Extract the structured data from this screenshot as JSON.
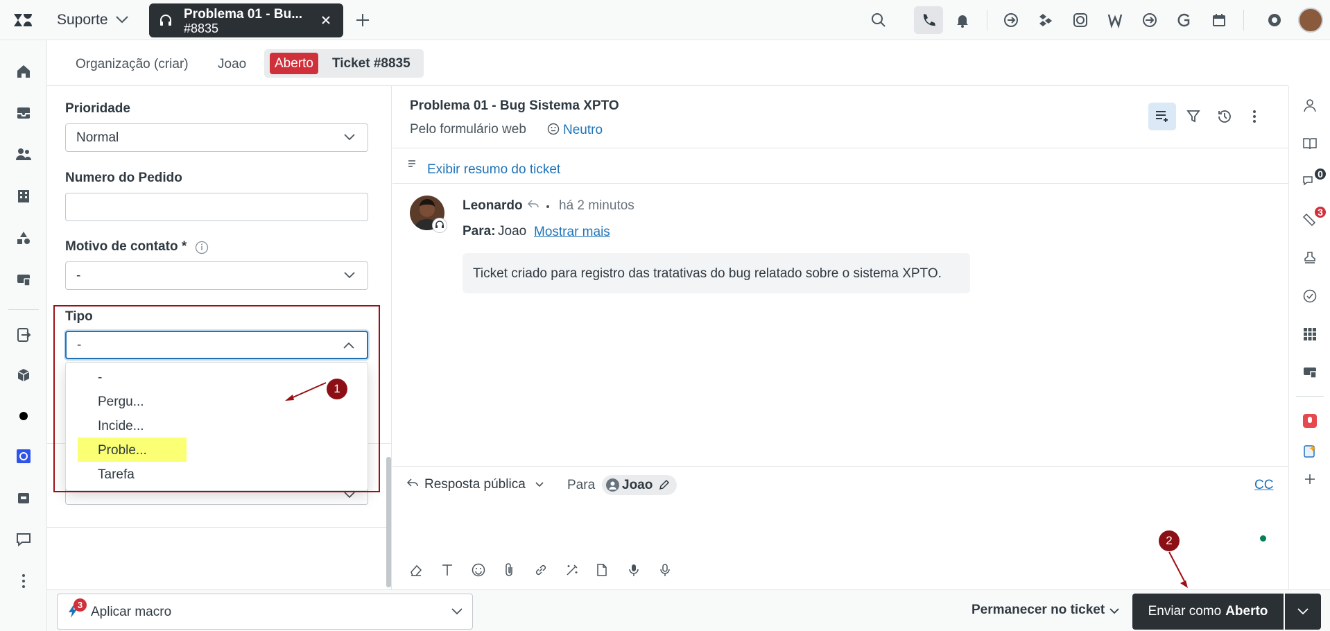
{
  "topbar": {
    "workspace": "Suporte",
    "tab_title": "Problema 01  - Bu...",
    "tab_subtitle": "#8835"
  },
  "breadcrumb": {
    "org": "Organização (criar)",
    "user": "Joao",
    "status": "Aberto",
    "ticket": "Ticket #8835"
  },
  "form": {
    "priority_label": "Prioridade",
    "priority_value": "Normal",
    "order_label": "Numero do Pedido",
    "order_value": "",
    "reason_label": "Motivo de contato *",
    "reason_value": "-",
    "type_label": "Tipo",
    "type_value": "-",
    "type_options": [
      "-",
      "Pergu...",
      "Incide...",
      "Proble...",
      "Tarefa"
    ]
  },
  "conversation": {
    "title": "Problema 01  - Bug Sistema XPTO",
    "channel": "Pelo formulário web",
    "sentiment": "Neutro",
    "summary_link": "Exibir resumo do ticket",
    "author": "Leonardo",
    "time": "há 2 minutos",
    "to_label": "Para:",
    "to_value": "Joao",
    "show_more": "Mostrar mais",
    "message": "Ticket criado para registro das tratativas do bug relatado sobre o sistema XPTO."
  },
  "reply": {
    "mode": "Resposta pública",
    "to_label": "Para",
    "recipient": "Joao",
    "cc": "CC"
  },
  "rightrail": {
    "chat_count": "0",
    "ticket_count": "3"
  },
  "bottombar": {
    "macro": "Aplicar macro",
    "macro_badge": "3",
    "stay": "Permanecer no ticket",
    "submit_prefix": "Enviar como",
    "submit_status": "Aberto"
  },
  "annotations": {
    "step1": "1",
    "step2": "2"
  },
  "colors": {
    "status_red": "#d0303a",
    "link_blue": "#1f73b7",
    "dark_button": "#2b3035",
    "annotation_red": "#9b0f14",
    "highlight_yellow": "#fbff73"
  }
}
